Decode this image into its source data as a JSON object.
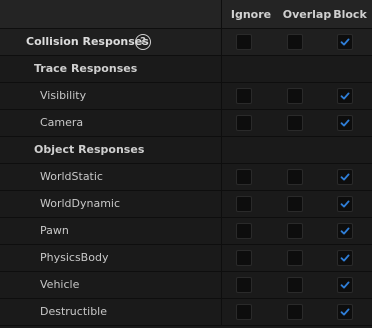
{
  "columns": {
    "ignore": "Ignore",
    "overlap": "Overlap",
    "block": "Block"
  },
  "collision": {
    "label": "Collision Responses",
    "help_icon": "question-circle-icon",
    "values": {
      "ignore": false,
      "overlap": false,
      "block": true
    }
  },
  "trace": {
    "label": "Trace Responses",
    "items": [
      {
        "label": "Visibility",
        "ignore": false,
        "overlap": false,
        "block": true
      },
      {
        "label": "Camera",
        "ignore": false,
        "overlap": false,
        "block": true
      }
    ]
  },
  "object": {
    "label": "Object Responses",
    "items": [
      {
        "label": "WorldStatic",
        "ignore": false,
        "overlap": false,
        "block": true
      },
      {
        "label": "WorldDynamic",
        "ignore": false,
        "overlap": false,
        "block": true
      },
      {
        "label": "Pawn",
        "ignore": false,
        "overlap": false,
        "block": true
      },
      {
        "label": "PhysicsBody",
        "ignore": false,
        "overlap": false,
        "block": true
      },
      {
        "label": "Vehicle",
        "ignore": false,
        "overlap": false,
        "block": true
      },
      {
        "label": "Destructible",
        "ignore": false,
        "overlap": false,
        "block": true
      }
    ]
  },
  "colors": {
    "check": "#2f7ed8",
    "background": "#1a1a1a"
  }
}
